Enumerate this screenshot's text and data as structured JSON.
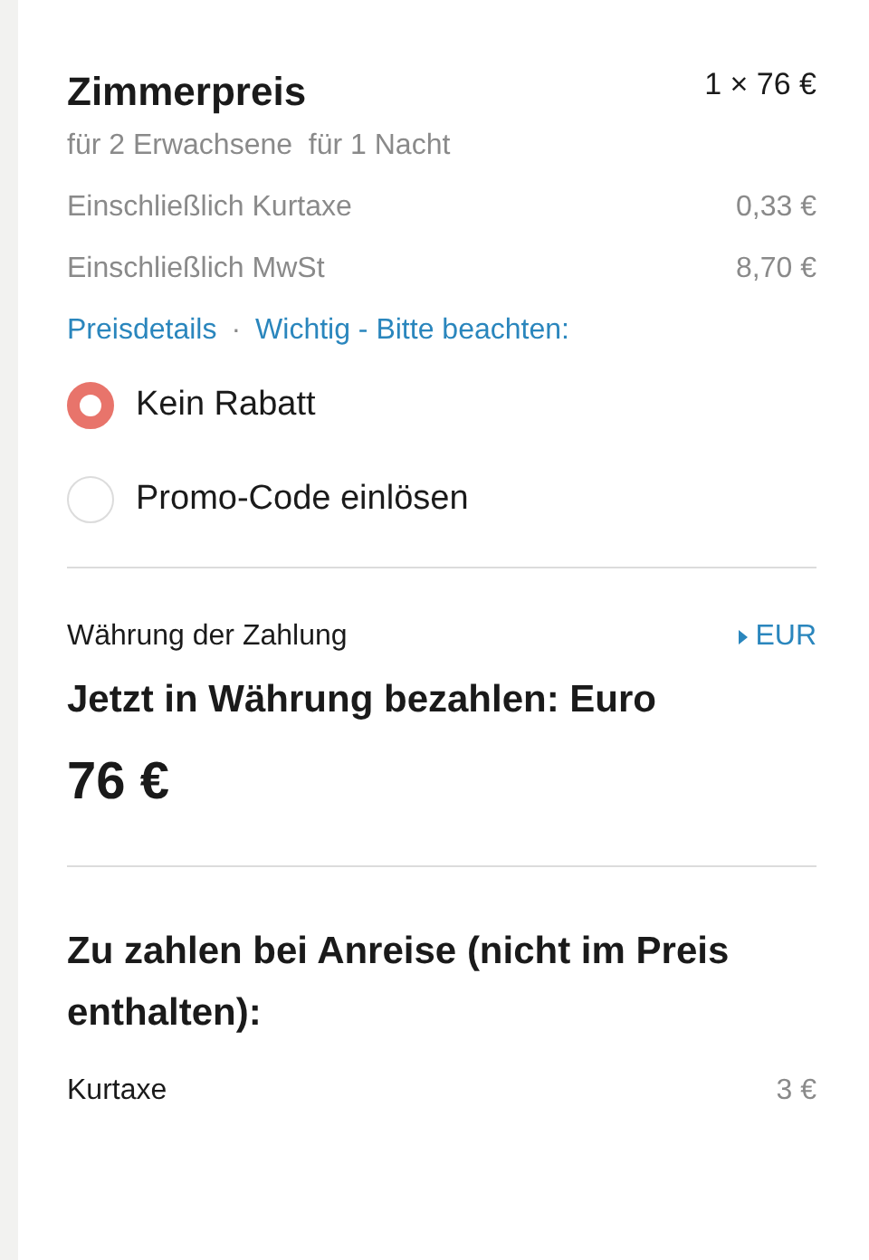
{
  "room_price": {
    "title": "Zimmerpreis",
    "quantity_price": "1 × 76 €",
    "guests_nights": "für 2 Erwachsene  für 1 Nacht",
    "included": [
      {
        "label": "Einschließlich Kurtaxe",
        "amount": "0,33 €"
      },
      {
        "label": "Einschließlich MwSt",
        "amount": "8,70 €"
      }
    ],
    "links": [
      "Preisdetails",
      "Wichtig - Bitte beachten:"
    ],
    "link_separator": "·"
  },
  "discount_options": [
    {
      "label": "Kein Rabatt",
      "selected": true
    },
    {
      "label": "Promo-Code einlösen",
      "selected": false
    }
  ],
  "payment_currency": {
    "label": "Währung der Zahlung",
    "currency_link": "EUR",
    "heading": "Jetzt in Währung bezahlen: Euro",
    "total": "76 €"
  },
  "pay_on_arrival": {
    "heading": "Zu zahlen bei Anreise (nicht im Preis enthalten):",
    "items": [
      {
        "label": "Kurtaxe",
        "amount": "3 €"
      }
    ]
  }
}
